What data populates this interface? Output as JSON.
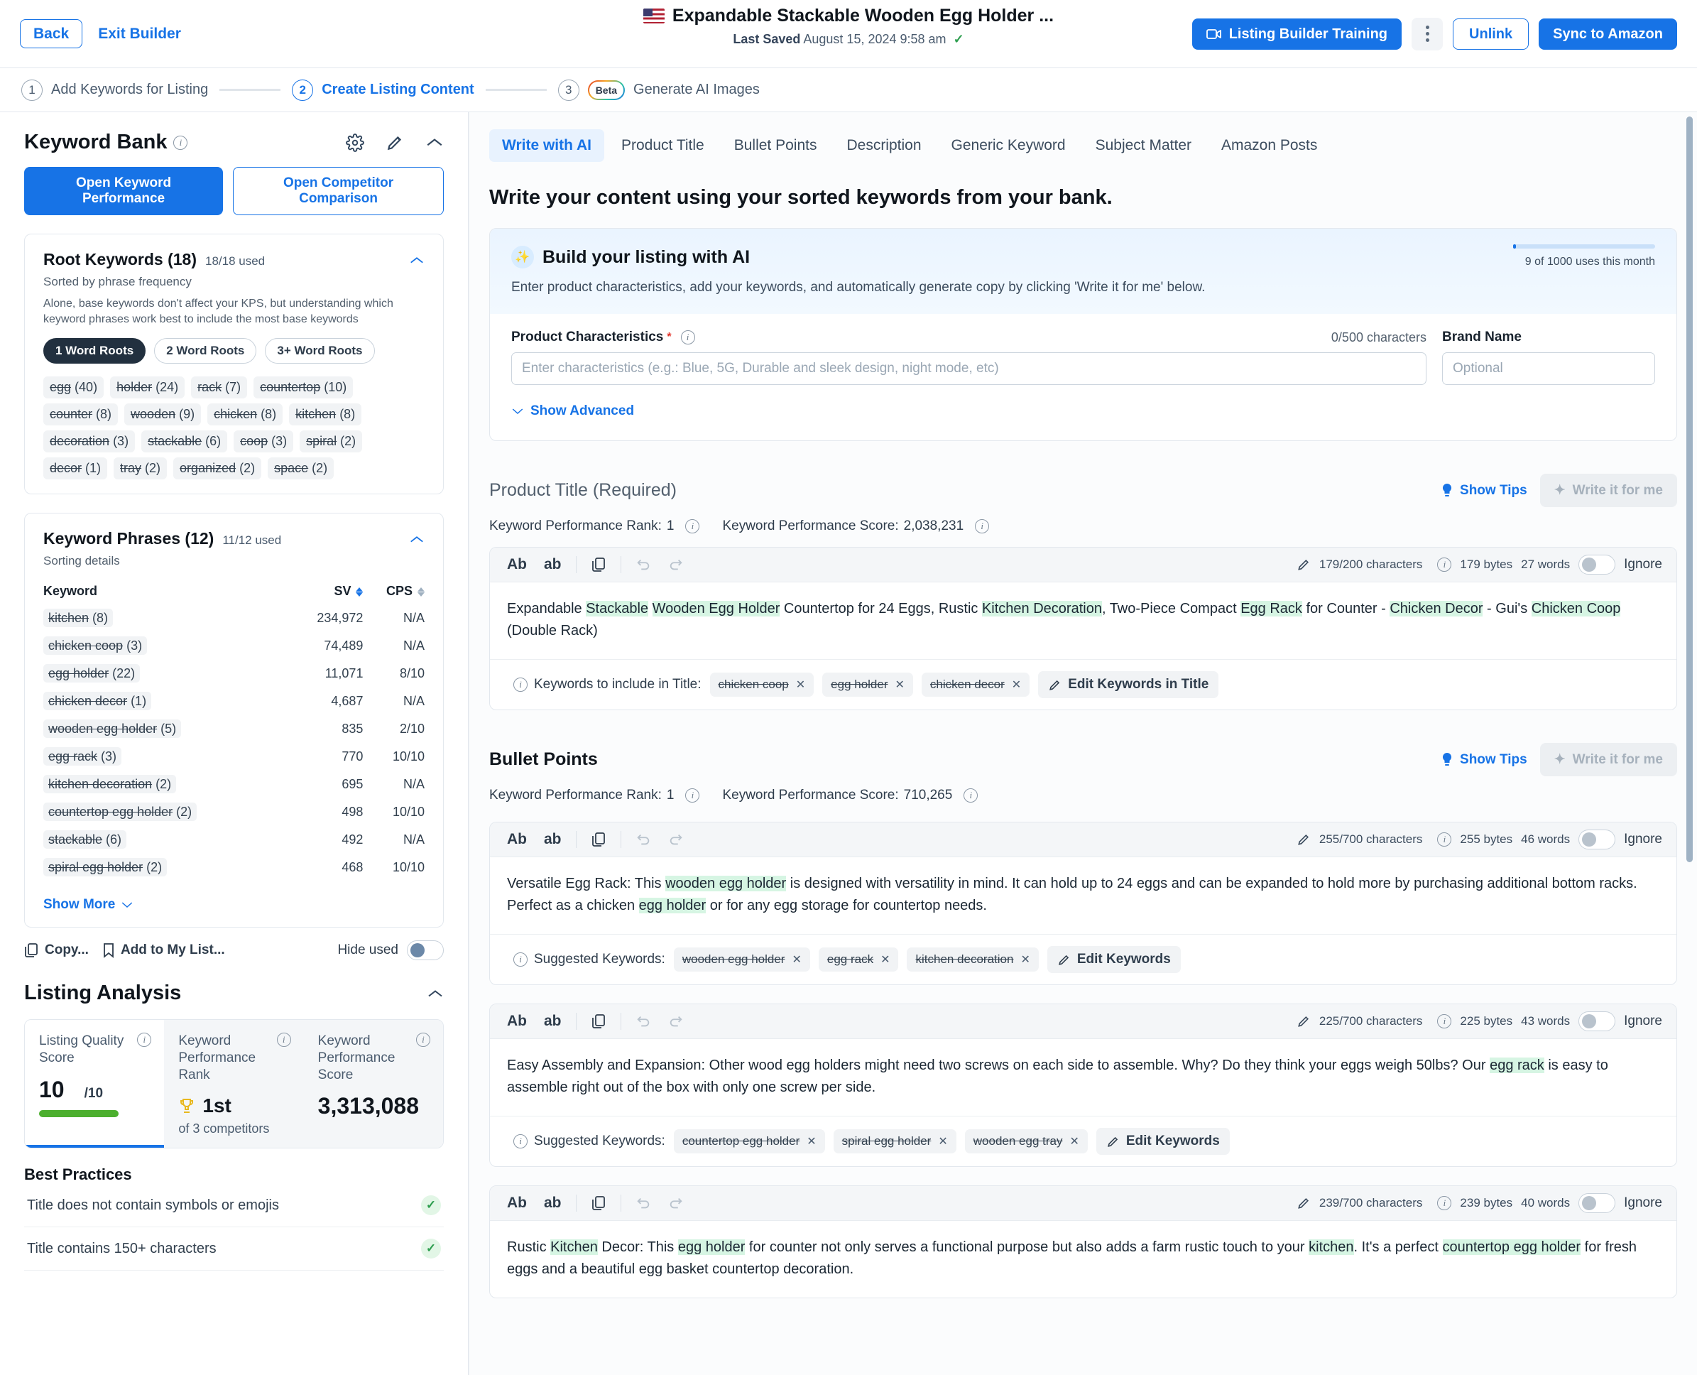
{
  "header": {
    "back_label": "Back",
    "exit_label": "Exit Builder",
    "doc_title": "Expandable Stackable Wooden Egg Holder ...",
    "last_saved_label": "Last Saved",
    "last_saved_value": "August 15, 2024 9:58 am",
    "training_label": "Listing Builder Training",
    "unlink_label": "Unlink",
    "sync_label": "Sync to Amazon"
  },
  "steps": [
    {
      "num": "1",
      "label": "Add Keywords for Listing"
    },
    {
      "num": "2",
      "label": "Create Listing Content"
    },
    {
      "num": "3",
      "label": "Generate AI Images",
      "badge": "Beta"
    }
  ],
  "sidebar": {
    "keyword_bank_title": "Keyword Bank",
    "open_keyword_performance": "Open Keyword Performance",
    "open_competitor_comparison": "Open Competitor Comparison",
    "root": {
      "title": "Root Keywords (18)",
      "used": "18/18 used",
      "sorted_by": "Sorted by phrase frequency",
      "description": "Alone, base keywords don't affect your KPS, but understanding which keyword phrases work best to include the most base keywords",
      "filters": [
        "1 Word Roots",
        "2 Word Roots",
        "3+ Word Roots"
      ],
      "active_filter": "1 Word Roots",
      "chips": [
        "egg (40)",
        "holder (24)",
        "rack (7)",
        "countertop (10)",
        "counter (8)",
        "wooden (9)",
        "chicken (8)",
        "kitchen (8)",
        "decoration (3)",
        "stackable (6)",
        "coop (3)",
        "spiral (2)",
        "decor (1)",
        "tray (2)",
        "organized (2)",
        "space (2)"
      ]
    },
    "phrases": {
      "title": "Keyword Phrases (12)",
      "used": "11/12 used",
      "sorting_details": "Sorting details",
      "columns": [
        "Keyword",
        "SV",
        "CPS"
      ],
      "rows": [
        {
          "keyword": "kitchen",
          "count": "(8)",
          "sv": "234,972",
          "cps": "N/A"
        },
        {
          "keyword": "chicken coop",
          "count": "(3)",
          "sv": "74,489",
          "cps": "N/A"
        },
        {
          "keyword": "egg holder",
          "count": "(22)",
          "sv": "11,071",
          "cps": "8/10"
        },
        {
          "keyword": "chicken decor",
          "count": "(1)",
          "sv": "4,687",
          "cps": "N/A"
        },
        {
          "keyword": "wooden egg holder",
          "count": "(5)",
          "sv": "835",
          "cps": "2/10"
        },
        {
          "keyword": "egg rack",
          "count": "(3)",
          "sv": "770",
          "cps": "10/10"
        },
        {
          "keyword": "kitchen decoration",
          "count": "(2)",
          "sv": "695",
          "cps": "N/A"
        },
        {
          "keyword": "countertop egg holder",
          "count": "(2)",
          "sv": "498",
          "cps": "10/10"
        },
        {
          "keyword": "stackable",
          "count": "(6)",
          "sv": "492",
          "cps": "N/A"
        },
        {
          "keyword": "spiral egg holder",
          "count": "(2)",
          "sv": "468",
          "cps": "10/10"
        }
      ],
      "show_more": "Show More"
    },
    "footer": {
      "copy_label": "Copy...",
      "add_to_list_label": "Add to My List...",
      "hide_used_label": "Hide used"
    },
    "listing_analysis": {
      "title": "Listing Analysis",
      "metrics": [
        {
          "label": "Listing Quality Score",
          "value": "10",
          "suffix": "/10"
        },
        {
          "label": "Keyword Performance Rank",
          "value": "1st",
          "sub": "of 3 competitors"
        },
        {
          "label": "Keyword Performance Score",
          "value": "3,313,088"
        }
      ],
      "best_practices_title": "Best Practices",
      "best_practices": [
        "Title does not contain symbols or emojis",
        "Title contains 150+ characters"
      ]
    }
  },
  "main": {
    "tabs": [
      "Write with AI",
      "Product Title",
      "Bullet Points",
      "Description",
      "Generic Keyword",
      "Subject Matter",
      "Amazon Posts"
    ],
    "active_tab": "Write with AI",
    "headline": "Write your content using your sorted keywords from your bank.",
    "ai": {
      "title": "Build your listing with AI",
      "subtitle": "Enter product characteristics, add your keywords, and automatically generate copy by clicking 'Write it for me' below.",
      "uses_text": "9 of 1000 uses this month",
      "characteristics_label": "Product Characteristics",
      "characteristics_count": "0/500 characters",
      "characteristics_placeholder": "Enter characteristics (e.g.: Blue, 5G, Durable and sleek design, night mode, etc)",
      "characteristics_value": "",
      "brand_label": "Brand Name",
      "brand_placeholder": "Optional",
      "brand_value": "",
      "show_advanced": "Show Advanced"
    },
    "common": {
      "show_tips": "Show Tips",
      "write_it_for_me": "Write it for me",
      "ignore": "Ignore",
      "kpr_label": "Keyword Performance Rank:",
      "kps_label": "Keyword Performance Score:",
      "edit_keywords_in_title": "Edit Keywords in Title",
      "edit_keywords": "Edit Keywords",
      "keywords_to_include": "Keywords to include in Title:",
      "suggested_keywords": "Suggested Keywords:"
    },
    "product_title": {
      "heading": "Product Title",
      "required": "(Required)",
      "kpr": "1",
      "kps": "2,038,231",
      "chars": "179/200 characters",
      "bytes": "179 bytes",
      "words": "27 words",
      "text_segments": [
        {
          "t": "Expandable ",
          "h": false
        },
        {
          "t": "Stackable",
          "h": true
        },
        {
          "t": " ",
          "h": false
        },
        {
          "t": "Wooden Egg Holder",
          "h": true
        },
        {
          "t": " Countertop for 24 Eggs, Rustic ",
          "h": false
        },
        {
          "t": "Kitchen Decoration",
          "h": true
        },
        {
          "t": ", Two-Piece Compact ",
          "h": false
        },
        {
          "t": "Egg Rack",
          "h": true
        },
        {
          "t": " for Counter - ",
          "h": false
        },
        {
          "t": "Chicken Decor",
          "h": true
        },
        {
          "t": " - Gui's ",
          "h": false
        },
        {
          "t": "Chicken Coop",
          "h": true
        },
        {
          "t": " (Double Rack)",
          "h": false
        }
      ],
      "keywords": [
        "chicken coop",
        "egg holder",
        "chicken decor"
      ]
    },
    "bullet_points": {
      "heading": "Bullet Points",
      "kpr": "1",
      "kps": "710,265",
      "items": [
        {
          "chars": "255/700 characters",
          "bytes": "255 bytes",
          "words": "46 words",
          "text_segments": [
            {
              "t": "Versatile Egg Rack: This ",
              "h": false
            },
            {
              "t": "wooden egg holder",
              "h": true
            },
            {
              "t": " is designed with versatility in mind. It can hold up to 24 eggs and can be expanded to hold more by purchasing additional bottom racks. Perfect as a chicken ",
              "h": false
            },
            {
              "t": "egg holder",
              "h": true
            },
            {
              "t": " or for any egg storage for countertop needs.",
              "h": false
            }
          ],
          "keywords": [
            "wooden egg holder",
            "egg rack",
            "kitchen decoration"
          ]
        },
        {
          "chars": "225/700 characters",
          "bytes": "225 bytes",
          "words": "43 words",
          "text_segments": [
            {
              "t": "Easy Assembly and Expansion: Other wood egg holders might need two screws on each side to assemble. Why? Do they think your eggs weigh 50lbs? Our ",
              "h": false
            },
            {
              "t": "egg rack",
              "h": true
            },
            {
              "t": " is easy to assemble right out of the box with only one screw per side.",
              "h": false
            }
          ],
          "keywords": [
            "countertop egg holder",
            "spiral egg holder",
            "wooden egg tray"
          ]
        },
        {
          "chars": "239/700 characters",
          "bytes": "239 bytes",
          "words": "40 words",
          "text_segments": [
            {
              "t": "Rustic ",
              "h": false
            },
            {
              "t": "Kitchen",
              "h": true
            },
            {
              "t": " Decor: This ",
              "h": false
            },
            {
              "t": "egg holder",
              "h": true
            },
            {
              "t": " for counter not only serves a functional purpose but also adds a farm rustic touch to your ",
              "h": false
            },
            {
              "t": "kitchen",
              "h": true
            },
            {
              "t": ". It's a perfect ",
              "h": false
            },
            {
              "t": "countertop egg holder",
              "h": true
            },
            {
              "t": " for fresh eggs and a beautiful egg basket countertop decoration.",
              "h": false
            }
          ],
          "keywords": []
        }
      ]
    }
  },
  "colors": {
    "accent": "#1773e6",
    "highlight": "#d6f5e3",
    "success": "#2e9e4f",
    "bar_green": "#4caf2e"
  }
}
